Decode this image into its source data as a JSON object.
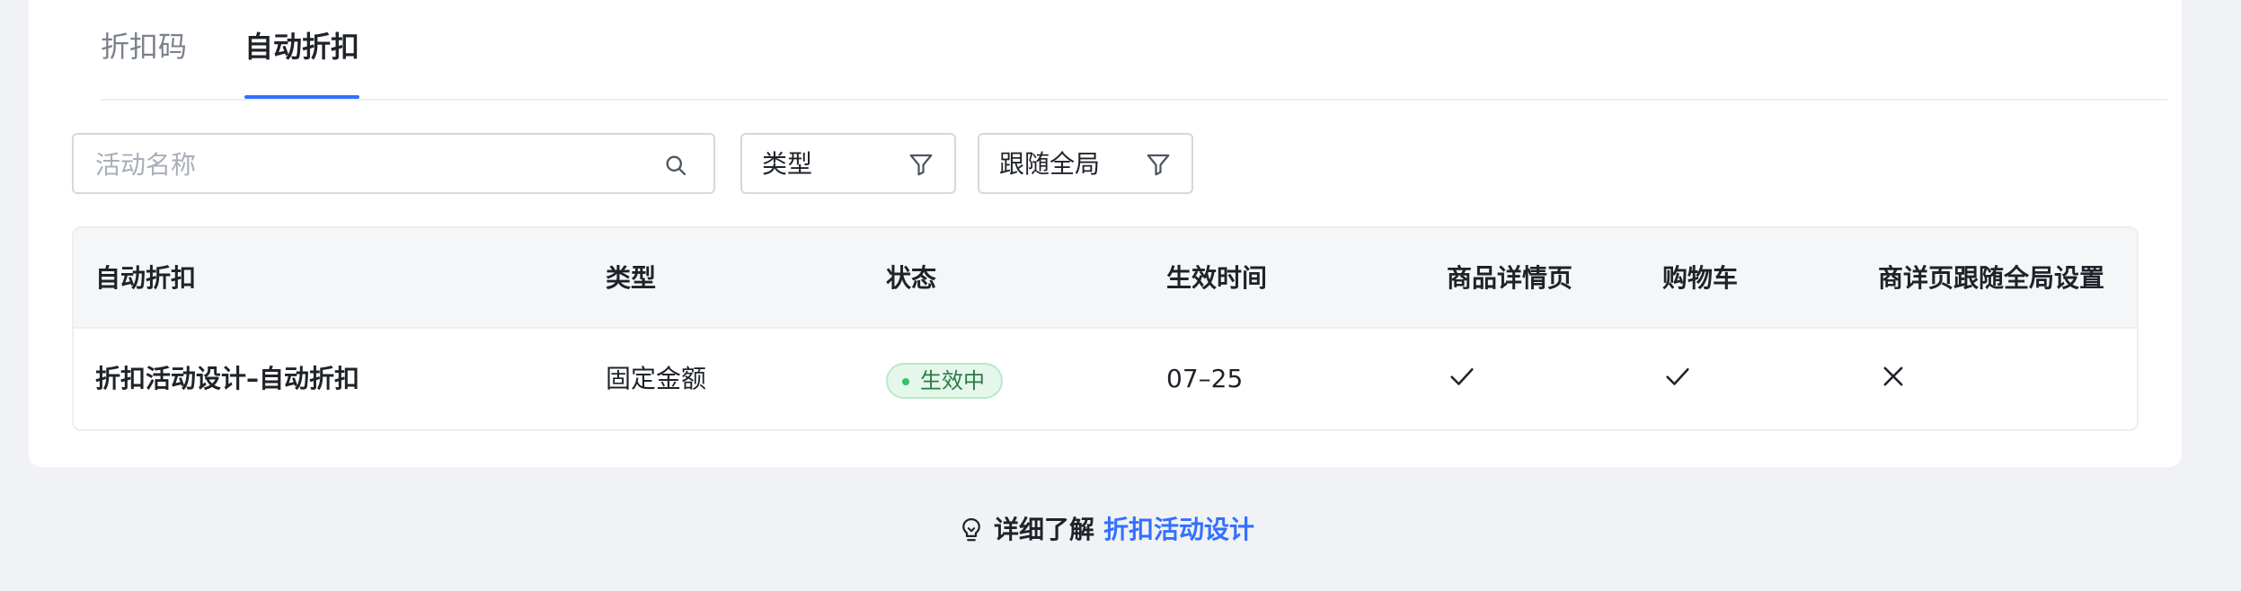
{
  "tabs": [
    {
      "label": "折扣码",
      "active": false
    },
    {
      "label": "自动折扣",
      "active": true
    }
  ],
  "filters": {
    "search_placeholder": "活动名称",
    "type_label": "类型",
    "global_label": "跟随全局"
  },
  "table": {
    "headers": [
      "自动折扣",
      "类型",
      "状态",
      "生效时间",
      "商品详情页",
      "购物车",
      "商详页跟随全局设置"
    ],
    "rows": [
      {
        "name": "折扣活动设计–自动折扣",
        "type": "固定金额",
        "status": "生效中",
        "effective_time": "07–25",
        "product_detail": "check-icon",
        "cart": "check-icon",
        "follow_global": "close-icon"
      }
    ]
  },
  "footer": {
    "text": "详细了解",
    "link": "折扣活动设计"
  },
  "colors": {
    "accent": "#3370ff",
    "status_bg": "#e4f7ea",
    "status_text": "#2b7a46",
    "page_bg": "#f1f2f5"
  }
}
